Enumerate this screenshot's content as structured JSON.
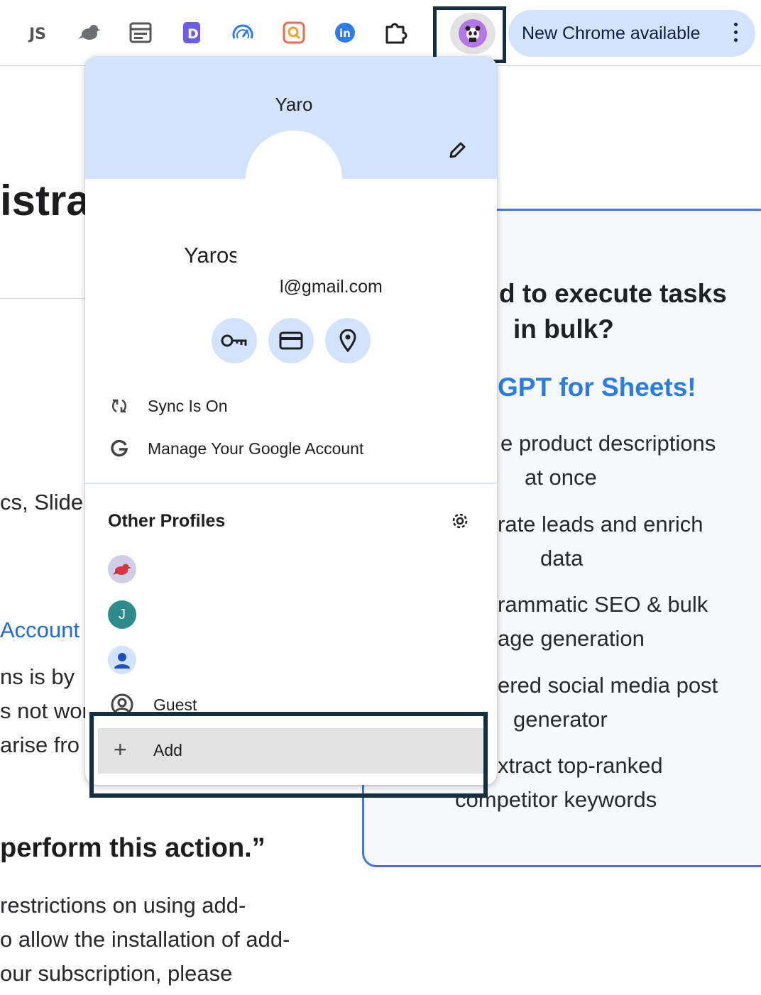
{
  "toolbar": {
    "extensions": [
      {
        "icon": "js-extension-icon"
      },
      {
        "icon": "bird-extension-icon"
      },
      {
        "icon": "screen-extension-icon"
      },
      {
        "icon": "d-extension-icon"
      },
      {
        "icon": "speed-extension-icon"
      },
      {
        "icon": "search-extension-icon"
      },
      {
        "icon": "linkedin-extension-icon"
      },
      {
        "icon": "puzzle-extensions-icon"
      }
    ],
    "update_label": "New Chrome available"
  },
  "background": {
    "title_fragment": "istra",
    "p1": "cs, Slide",
    "link": "Account",
    "p2": "ns is by",
    "p3": "s not wor",
    "p4": "arise fro",
    "h2": "perform this action.”",
    "p5": "restrictions on using add-",
    "p6": "o allow the installation of add-",
    "p7": "our subscription, please"
  },
  "promo": {
    "heading_line1": "d to execute tasks",
    "heading_line2": "in bulk?",
    "subheading": "GPT for Sheets!",
    "items": [
      [
        "e product descriptions",
        "at once"
      ],
      [
        "rate leads and enrich",
        "data"
      ],
      [
        "rammatic SEO & bulk",
        "age generation"
      ],
      [
        "ered social media post",
        "generator"
      ],
      [
        "xtract top-ranked",
        "competitor keywords"
      ]
    ]
  },
  "profile_menu": {
    "header_name": "Yaro",
    "account_name": "Yaros",
    "account_email": "l@gmail.com",
    "quick_actions": [
      "passwords-key-icon",
      "payment-card-icon",
      "addresses-pin-icon"
    ],
    "sync_label": "Sync Is On",
    "manage_label": "Manage Your Google Account",
    "other_profiles_title": "Other Profiles",
    "profiles": [
      {
        "avatar": "bird-avatar"
      },
      {
        "avatar": "letter-avatar",
        "initial": "J",
        "color": "#2e8b8b"
      },
      {
        "avatar": "person-avatar"
      }
    ],
    "guest_label": "Guest",
    "add_label": "Add"
  },
  "colors": {
    "accent": "#d3e3fd",
    "highlight_box": "#143040",
    "promo_border": "#3c7be6",
    "link": "#1e6ad6"
  }
}
